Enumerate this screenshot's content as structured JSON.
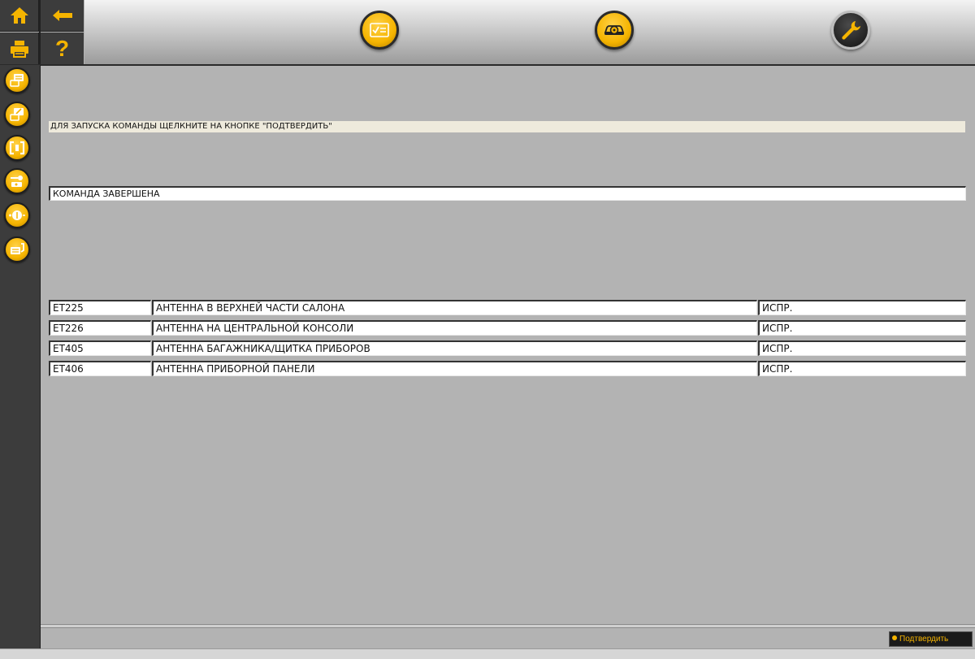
{
  "toolbar": {
    "home_icon": "home-icon",
    "back_icon": "arrow-left-icon",
    "print_icon": "printer-icon",
    "help_icon": "question-mark-icon",
    "help_glyph": "?"
  },
  "top_buttons": [
    {
      "icon": "checklist-icon",
      "state": "normal"
    },
    {
      "icon": "vehicle-diagnostic-icon",
      "state": "normal"
    },
    {
      "icon": "wrench-icon",
      "state": "active"
    }
  ],
  "sidebar": {
    "items": [
      {
        "icon": "ecu-list-icon"
      },
      {
        "icon": "ecu-edit-icon"
      },
      {
        "icon": "bracket-measure-icon"
      },
      {
        "icon": "actuator-test-icon"
      },
      {
        "icon": "plus-minus-icon"
      },
      {
        "icon": "ecu-config-icon"
      }
    ]
  },
  "main": {
    "instruction": "ДЛЯ ЗАПУСКА КОМАНДЫ ЩЕЛКНИТЕ НА КНОПКЕ \"ПОДТВЕРДИТЬ\"",
    "status": "КОМАНДА ЗАВЕРШЕНА",
    "rows": [
      {
        "code": "ET225",
        "description": "АНТЕННА В ВЕРХНЕЙ ЧАСТИ САЛОНА",
        "state": "ИСПР."
      },
      {
        "code": "ET226",
        "description": "АНТЕННА НА ЦЕНТРАЛЬНОЙ КОНСОЛИ",
        "state": "ИСПР."
      },
      {
        "code": "ET405",
        "description": "АНТЕННА БАГАЖНИКА/ЩИТКА ПРИБОРОВ",
        "state": "ИСПР."
      },
      {
        "code": "ET406",
        "description": "АНТЕННА ПРИБОРНОЙ ПАНЕЛИ",
        "state": "ИСПР."
      }
    ]
  },
  "footer": {
    "confirm_label": "Подтвердить"
  },
  "colors": {
    "accent": "#f5b400",
    "panel_dark": "#3c3c3c",
    "content_bg": "#b3b3b3"
  }
}
